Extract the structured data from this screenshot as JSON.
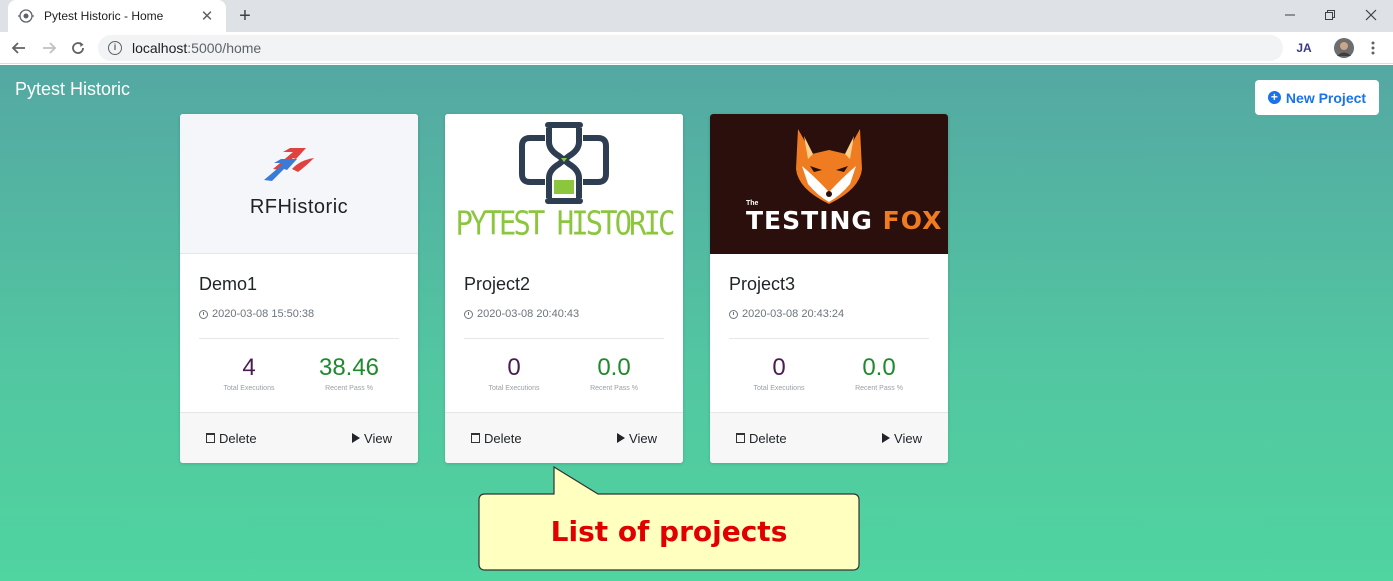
{
  "browser": {
    "tab_title": "Pytest Historic - Home",
    "new_tab_label": "+",
    "url_host": "localhost",
    "url_rest": ":5000/home",
    "extension_label": "JA"
  },
  "app": {
    "brand": "Pytest Historic",
    "new_project_label": "New Project"
  },
  "projects": [
    {
      "name": "Demo1",
      "date": "2020-03-08 15:50:38",
      "total_executions": "4",
      "recent_pass": "38.46",
      "logo_text": "RFHistoric"
    },
    {
      "name": "Project2",
      "date": "2020-03-08 20:40:43",
      "total_executions": "0",
      "recent_pass": "0.0",
      "logo_text": "PYTEST HISTORIC"
    },
    {
      "name": "Project3",
      "date": "2020-03-08 20:43:24",
      "total_executions": "0",
      "recent_pass": "0.0",
      "logo_text_prefix": "The",
      "logo_text_a": "TESTING",
      "logo_text_b": "FOX"
    }
  ],
  "labels": {
    "total_executions": "Total Executions",
    "recent_pass": "Recent Pass %",
    "delete": "Delete",
    "view": "View"
  },
  "callout": {
    "text": "List of projects"
  },
  "colors": {
    "accent": "#1a73e8",
    "executions": "#4a1d52",
    "pass": "#1e8a2c",
    "callout_fill": "#ffffc0",
    "callout_text": "#e00000"
  }
}
